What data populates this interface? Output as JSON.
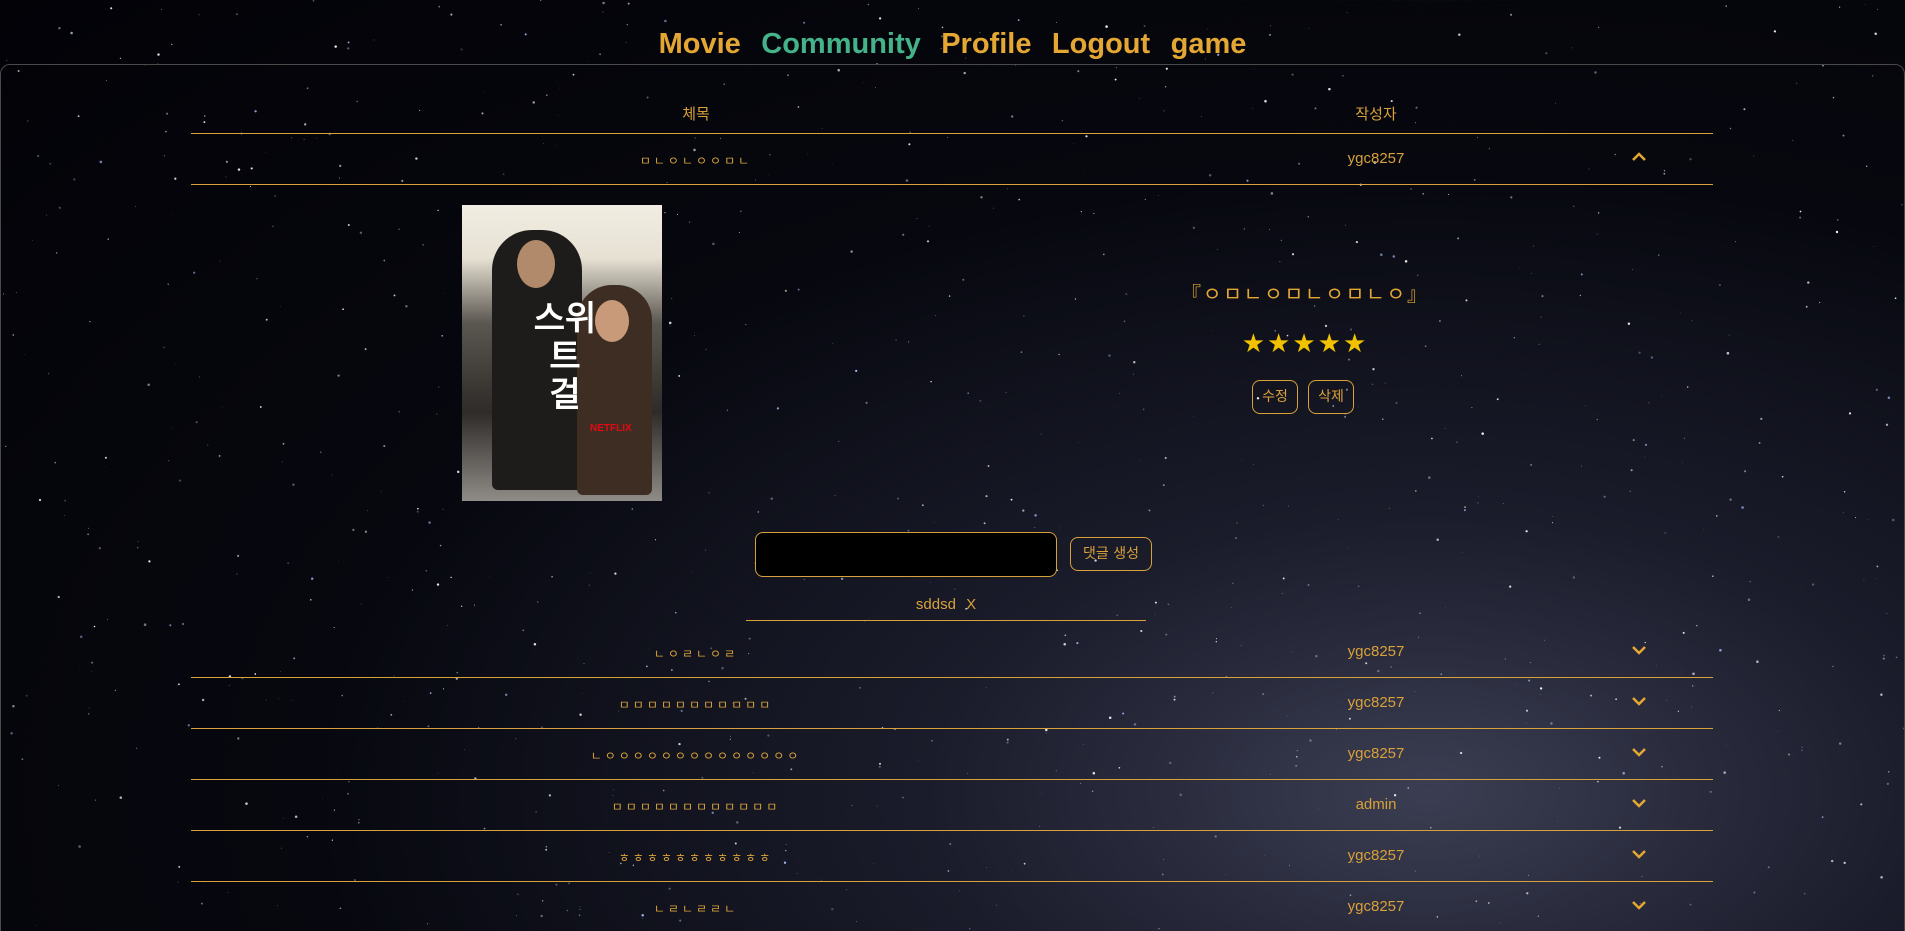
{
  "nav": {
    "items": [
      {
        "label": "Movie",
        "active": false
      },
      {
        "label": "Community",
        "active": true
      },
      {
        "label": "Profile",
        "active": false
      },
      {
        "label": "Logout",
        "active": false
      },
      {
        "label": "game",
        "active": false
      }
    ]
  },
  "table": {
    "header_title": "체목",
    "header_author": "작성자"
  },
  "open_post": {
    "title": "ㅁㄴㅇㄴㅇㅇㅁㄴ",
    "author": "ygc8257",
    "chevron": "chevron-up-icon"
  },
  "review": {
    "poster_title": "스위트 걸",
    "poster_logo": "NETFLIX",
    "title": "『ㅇㅁㄴㅇㅁㄴㅇㅁㄴㅇ』",
    "rating": 5,
    "stars": "★★★★★",
    "edit_label": "수정",
    "delete_label": "삭제"
  },
  "comment_form": {
    "input_value": "",
    "submit_label": "댓글 생성"
  },
  "comments": [
    {
      "text": "sddsd",
      "delete_label": "X"
    }
  ],
  "posts": [
    {
      "title": "ㄴㅇㄹㄴㅇㄹ",
      "author": "ygc8257"
    },
    {
      "title": "ㅁㅁㅁㅁㅁㅁㅁㅁㅁㅁㅁ",
      "author": "ygc8257"
    },
    {
      "title": "ㄴㅇㅇㅇㅇㅇㅇㅇㅇㅇㅇㅇㅇㅇㅇ",
      "author": "ygc8257"
    },
    {
      "title": "ㅁㅁㅁㅁㅁㅁㅁㅁㅁㅁㅁㅁ",
      "author": "admin"
    },
    {
      "title": "ㅎㅎㅎㅎㅎㅎㅎㅎㅎㅎㅎ",
      "author": "ygc8257"
    },
    {
      "title": "ㄴㄹㄴㄹㄹㄴ",
      "author": "ygc8257"
    }
  ],
  "colors": {
    "accent": "#d9a13a",
    "nav": "#e5a733",
    "nav_active": "#45b38a",
    "star": "#f2c200"
  }
}
